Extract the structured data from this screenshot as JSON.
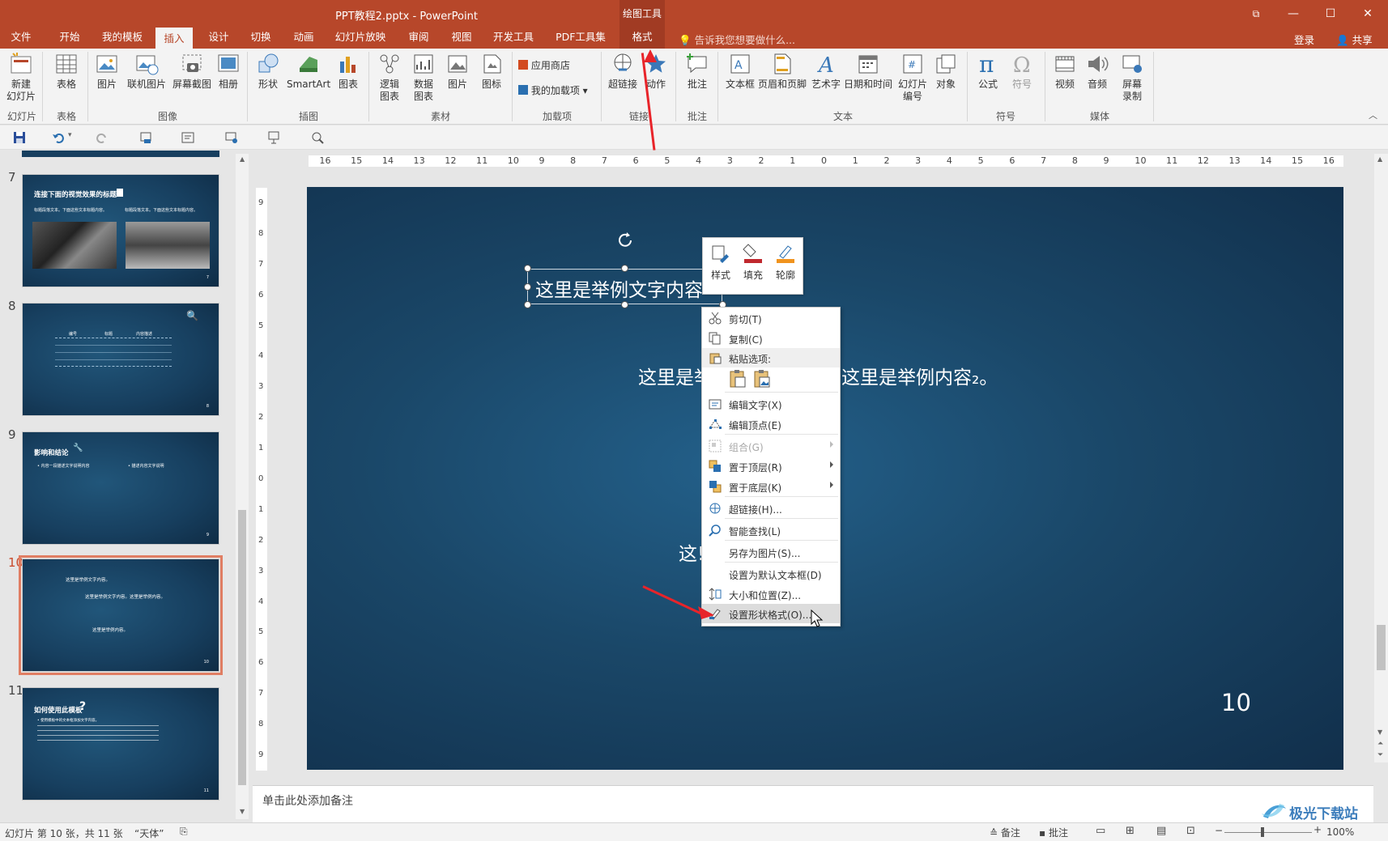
{
  "window": {
    "doc_title": "PPT教程2.pptx - PowerPoint",
    "context_group": "绘图工具",
    "restore_glyph": "⧉",
    "minimize_glyph": "—",
    "maximize_glyph": "☐",
    "close_glyph": "✕"
  },
  "tabs": [
    "文件",
    "开始",
    "我的模板",
    "插入",
    "设计",
    "切换",
    "动画",
    "幻灯片放映",
    "审阅",
    "视图",
    "开发工具",
    "PDF工具集",
    "格式"
  ],
  "active_tab": "插入",
  "tellme": "告诉我您想要做什么...",
  "login": "登录",
  "share": "共享",
  "ribbon": {
    "new_slide": "新建\n幻灯片",
    "table": "表格",
    "picture": "图片",
    "online_picture": "联机图片",
    "screenshot": "屏幕截图",
    "album": "相册",
    "shapes": "形状",
    "smartart": "SmartArt",
    "chart": "图表",
    "logic_chart": "逻辑\n图表",
    "data_chart": "数据\n图表",
    "picture2": "图片",
    "icon": "图标",
    "app_store": "应用商店",
    "my_addins": "我的加载项",
    "hyperlink": "超链接",
    "action": "动作",
    "comment": "批注",
    "textbox": "文本框",
    "header_footer": "页眉和页脚",
    "wordart": "艺术字",
    "datetime": "日期和时间",
    "slide_number": "幻灯片\n编号",
    "object": "对象",
    "equation": "公式",
    "symbol": "符号",
    "video": "视频",
    "audio": "音频",
    "screen_record": "屏幕\n录制",
    "groups": {
      "slides": "幻灯片",
      "tables": "表格",
      "images": "图像",
      "illustrations": "插图",
      "material": "素材",
      "addins": "加载项",
      "links": "链接",
      "comments": "批注",
      "text": "文本",
      "symbols": "符号",
      "media": "媒体"
    }
  },
  "thumbnails": [
    {
      "number": "7",
      "title": "连接下面的视觉效果的标题",
      "body1": "标题段落文本。下面这些文本标题内容。",
      "body2": "标题段落文本。下面这些文本标题内容。",
      "num": "7"
    },
    {
      "number": "8",
      "col1": "编号",
      "col2": "标题",
      "col3": "内容描述",
      "num": "8"
    },
    {
      "number": "9",
      "title": "影响和结论",
      "body1": "• 内容一段描述文字说明内容",
      "body2": "• 描述内容文字说明",
      "num": "9"
    },
    {
      "number": "10",
      "line1": "这里是举例文字内容。",
      "line2": "这里是举例文字内容。这里是举例内容。",
      "line3": "这里是举例内容。",
      "num": "10"
    },
    {
      "number": "11",
      "title": "如何使用此模板",
      "body": "• 使用模板中的文本框添加文字内容。",
      "num": "11"
    }
  ],
  "slide": {
    "textbox": "这里是举例文字内容",
    "line2_left": "这里是举",
    "line2_right": "这里是举例内容₂。",
    "line3": "这!",
    "page_number": "10"
  },
  "mini_toolbar": {
    "style": "样式",
    "fill": "填充",
    "outline": "轮廓"
  },
  "context_menu": {
    "cut": "剪切(T)",
    "copy": "复制(C)",
    "paste_options": "粘贴选项:",
    "edit_text": "编辑文字(X)",
    "edit_points": "编辑顶点(E)",
    "group": "组合(G)",
    "bring_front": "置于顶层(R)",
    "send_back": "置于底层(K)",
    "hyperlink": "超链接(H)...",
    "smart_lookup": "智能查找(L)",
    "save_as_picture": "另存为图片(S)...",
    "set_default_textbox": "设置为默认文本框(D)",
    "size_position": "大小和位置(Z)...",
    "format_shape": "设置形状格式(O)..."
  },
  "ruler": {
    "h_labels": [
      "16",
      "15",
      "14",
      "13",
      "12",
      "11",
      "10",
      "9",
      "8",
      "7",
      "6",
      "5",
      "4",
      "3",
      "2",
      "1",
      "0",
      "1",
      "2",
      "3",
      "4",
      "5",
      "6",
      "7",
      "8",
      "9",
      "10",
      "11",
      "12",
      "13",
      "14",
      "15",
      "16"
    ],
    "v_labels": [
      "9",
      "8",
      "7",
      "6",
      "5",
      "4",
      "3",
      "2",
      "1",
      "0",
      "1",
      "2",
      "3",
      "4",
      "5",
      "6",
      "7",
      "8",
      "9"
    ]
  },
  "notes_placeholder": "单击此处添加备注",
  "status": {
    "slide_info": "幻灯片 第 10 张，共 11 张",
    "theme": "“天体”",
    "notes": "备注",
    "comments": "批注",
    "zoom": "100%"
  },
  "watermark": "极光下载站",
  "colors": {
    "accent": "#b7472a",
    "annotation_arrow": "#e8242a"
  }
}
